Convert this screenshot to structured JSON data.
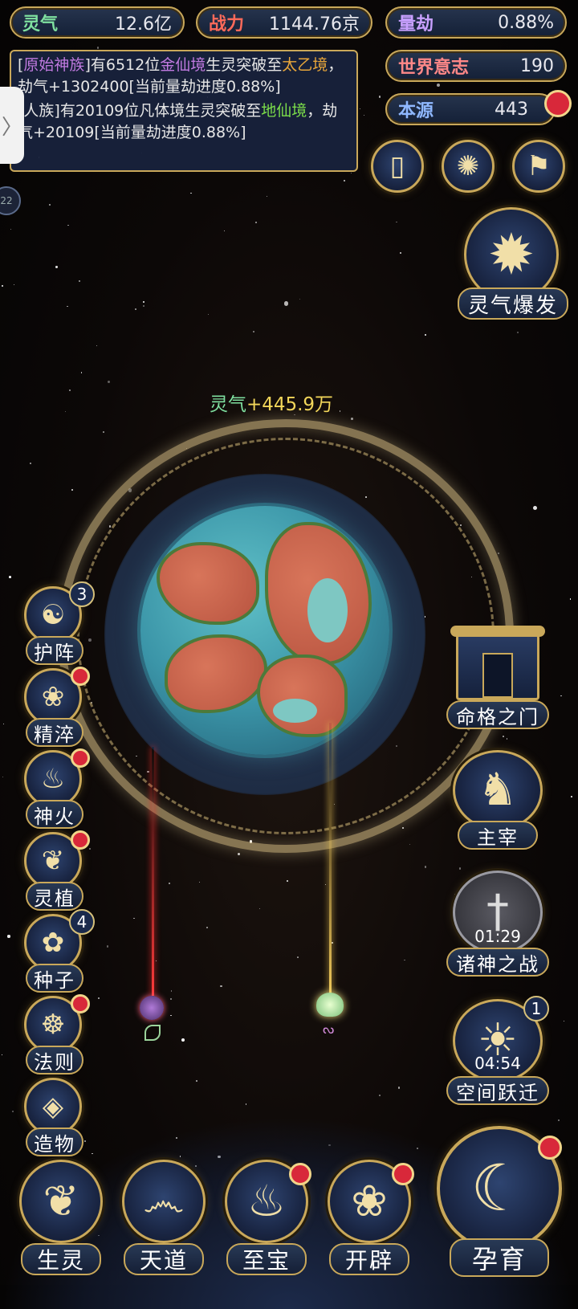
{
  "stats": {
    "lingqi": {
      "label": "灵气",
      "value": "12.6亿",
      "color": "#7fe0a0"
    },
    "zhanli": {
      "label": "战力",
      "value": "1144.76京",
      "color": "#ff6a5a"
    },
    "liangjie": {
      "label": "量劫",
      "value": "0.88%",
      "color": "#c8a0ff"
    },
    "shijie": {
      "label": "世界意志",
      "value": "190",
      "color": "#ff8888"
    },
    "benyuan": {
      "label": "本源",
      "value": "443",
      "color": "#8fb8ff"
    }
  },
  "log": {
    "line1": {
      "a": "[",
      "b": "原始神族",
      "c": "]有6512位",
      "d": "金仙境",
      "e": "生灵突破至",
      "f": "太乙境",
      "g": "，劫气+1302400[当前量劫进度0.88%]"
    },
    "line2": {
      "a": "[人族]有20109位凡体境生灵突破至",
      "b": "地仙境",
      "c": "，劫气+20109[当前量劫进度0.88%]"
    },
    "overlay": "当前量"
  },
  "side_tab": "〉",
  "side_dot": "22",
  "gain_text": {
    "label": "灵气",
    "value": "+445.9万"
  },
  "top_icons": [
    "card-icon",
    "vortex-icon",
    "flag-icon"
  ],
  "burst": {
    "label": "灵气爆发"
  },
  "left_menu": [
    {
      "label": "护阵",
      "badge": "3",
      "dot": false,
      "glyph": "☯"
    },
    {
      "label": "精淬",
      "badge": "",
      "dot": true,
      "glyph": "❀"
    },
    {
      "label": "神火",
      "badge": "",
      "dot": true,
      "glyph": "♨"
    },
    {
      "label": "灵植",
      "badge": "",
      "dot": true,
      "glyph": "❦"
    },
    {
      "label": "种子",
      "badge": "4",
      "dot": false,
      "glyph": "✿"
    },
    {
      "label": "法则",
      "badge": "",
      "dot": true,
      "glyph": "☸"
    },
    {
      "label": "造物",
      "badge": "",
      "dot": false,
      "glyph": "◈"
    }
  ],
  "right_menu": {
    "gate": {
      "label": "命格之门"
    },
    "master": {
      "label": "主宰"
    },
    "war": {
      "label": "诸神之战",
      "timer": "01:29"
    },
    "jump": {
      "label": "空间跃迁",
      "timer": "04:54",
      "badge": "1"
    }
  },
  "bottom_menu": [
    {
      "label": "生灵",
      "dot": false
    },
    {
      "label": "天道",
      "dot": false
    },
    {
      "label": "至宝",
      "dot": true
    },
    {
      "label": "开辟",
      "dot": true
    }
  ],
  "breed": {
    "label": "孕育"
  }
}
